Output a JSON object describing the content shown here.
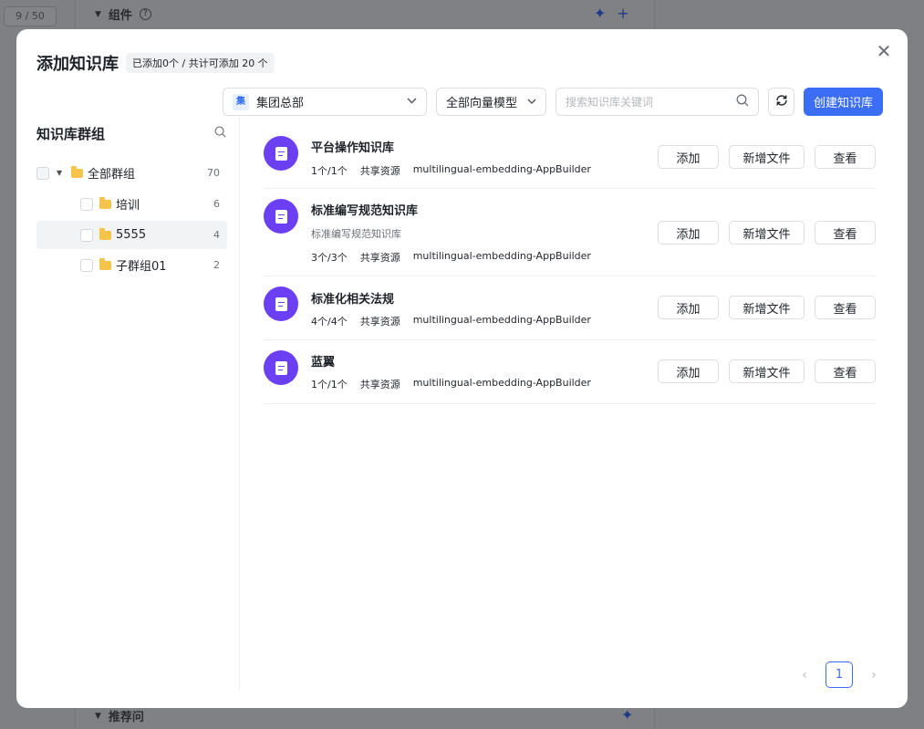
{
  "background": {
    "counter": "9 / 50",
    "components_label": "组件",
    "recommend_label": "推荐问"
  },
  "modal": {
    "title": "添加知识库",
    "quota": "已添加0个 / 共计可添加 20 个",
    "close_icon": "close-icon"
  },
  "toolbar": {
    "org_chip": "集",
    "org_value": "集团总部",
    "model_value": "全部向量模型",
    "search_placeholder": "搜索知识库关键词",
    "create_label": "创建知识库"
  },
  "groups": {
    "title": "知识库群组",
    "items": [
      {
        "label": "全部群组",
        "count": "70"
      },
      {
        "label": "培训",
        "count": "6"
      },
      {
        "label": "5555",
        "count": "4"
      },
      {
        "label": "子群组01",
        "count": "2"
      }
    ]
  },
  "knowledge_bases": [
    {
      "name": "平台操作知识库",
      "desc": "",
      "files": "1个/1个",
      "share": "共享资源",
      "model": "multilingual-embedding-AppBuilder"
    },
    {
      "name": "标准编写规范知识库",
      "desc": "标准编写规范知识库",
      "files": "3个/3个",
      "share": "共享资源",
      "model": "multilingual-embedding-AppBuilder"
    },
    {
      "name": "标准化相关法规",
      "desc": "",
      "files": "4个/4个",
      "share": "共享资源",
      "model": "multilingual-embedding-AppBuilder"
    },
    {
      "name": "蓝翼",
      "desc": "",
      "files": "1个/1个",
      "share": "共享资源",
      "model": "multilingual-embedding-AppBuilder"
    }
  ],
  "actions": {
    "add": "添加",
    "add_file": "新增文件",
    "view": "查看"
  },
  "pagination": {
    "current": "1",
    "prev_arrow": "‹",
    "next_arrow": "›"
  },
  "colors": {
    "primary": "#3b6ef5",
    "avatar": "#6b3ff2",
    "folder": "#f7c44b"
  }
}
